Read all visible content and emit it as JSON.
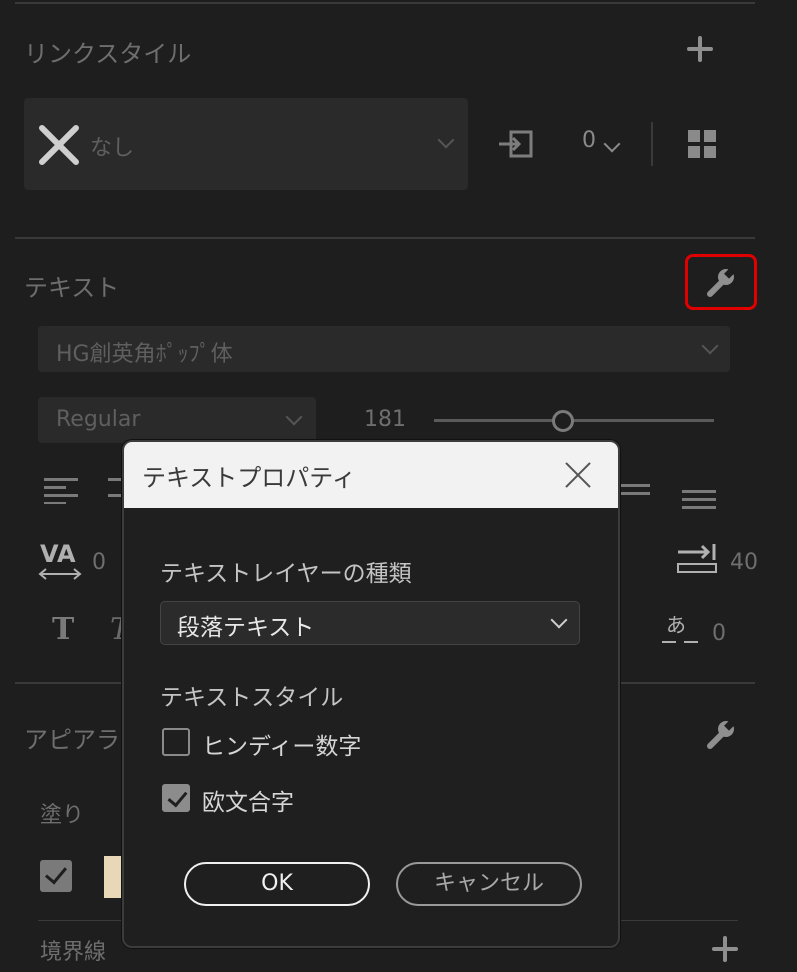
{
  "link_style": {
    "title": "リンクスタイル",
    "dropdown_value": "なし",
    "count_value": "0"
  },
  "text_section": {
    "title": "テキスト",
    "font_family": "HG創英角ﾎﾟｯﾌﾟ体",
    "font_style": "Regular",
    "font_size": "181",
    "font_size_fraction": 0.46,
    "tracking_value": "0",
    "indent_value": "40",
    "tsume_value": "0"
  },
  "appearance": {
    "title_visible": "アピアラ",
    "fill_label": "塗り",
    "stroke_label": "境界線",
    "fill_color": "#e8d8b8"
  },
  "dialog": {
    "title": "テキストプロパティ",
    "layer_type_label": "テキストレイヤーの種類",
    "layer_type_value": "段落テキスト",
    "text_style_label": "テキストスタイル",
    "option1_label": "ヒンディー数字",
    "option1_checked": false,
    "option2_label": "欧文合字",
    "option2_checked": true,
    "ok_label": "OK",
    "cancel_label": "キャンセル"
  },
  "colors": {
    "highlight": "#e00000",
    "panel_bg": "#1e1e1e",
    "dialog_header": "#f2f2f2"
  }
}
